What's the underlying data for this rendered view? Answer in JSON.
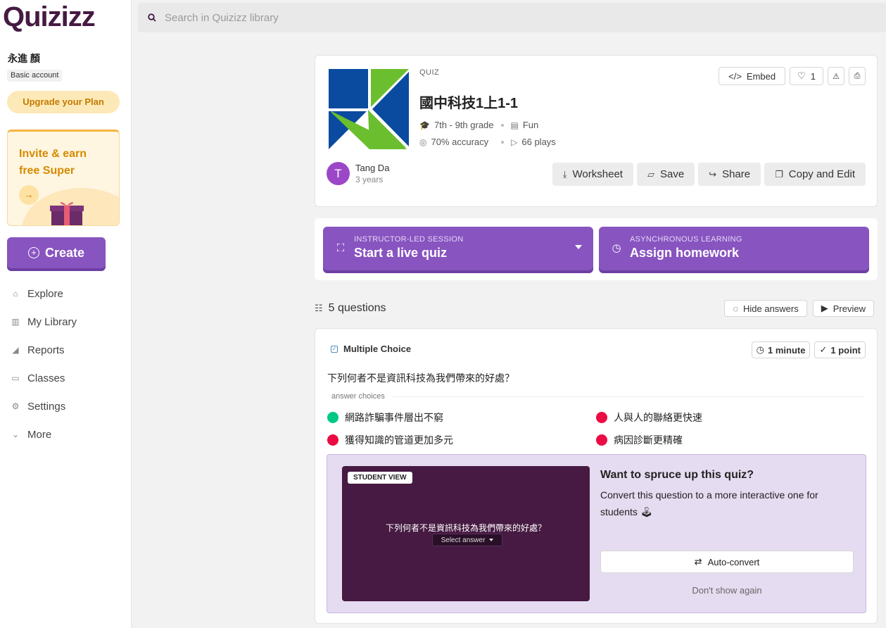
{
  "app": {
    "logo": "Quizizz"
  },
  "sidebar": {
    "user_name": "永進 顏",
    "account_type": "Basic account",
    "upgrade_label": "Upgrade your Plan",
    "invite_title": "Invite & earn free Super",
    "create_label": "Create",
    "nav": [
      {
        "label": "Explore",
        "icon": "compass-icon"
      },
      {
        "label": "My Library",
        "icon": "library-icon"
      },
      {
        "label": "Reports",
        "icon": "reports-icon"
      },
      {
        "label": "Classes",
        "icon": "classes-icon"
      },
      {
        "label": "Settings",
        "icon": "gear-icon"
      },
      {
        "label": "More",
        "icon": "chevron-down-icon"
      }
    ]
  },
  "search": {
    "placeholder": "Search in Quizizz library"
  },
  "quiz": {
    "type_label": "QUIZ",
    "title": "國中科技1上1-1",
    "grade": "7th - 9th grade",
    "category": "Fun",
    "accuracy": "70% accuracy",
    "plays": "66 plays",
    "embed_label": "Embed",
    "likes": "1",
    "author": "Tang Da",
    "author_initial": "T",
    "author_time": "3 years",
    "actions": {
      "worksheet": "Worksheet",
      "save": "Save",
      "share": "Share",
      "copy_edit": "Copy and Edit"
    }
  },
  "session": {
    "live_sub": "INSTRUCTOR-LED SESSION",
    "live_main": "Start a live quiz",
    "hw_sub": "ASYNCHRONOUS LEARNING",
    "hw_main": "Assign homework"
  },
  "questions": {
    "count_label": "5 questions",
    "hide_answers": "Hide answers",
    "preview": "Preview"
  },
  "question": {
    "type": "Multiple Choice",
    "time": "1 minute",
    "points": "1 point",
    "text": "下列何者不是資訊科技為我們帶來的好處？",
    "answer_label": "answer choices",
    "answers": [
      {
        "text": "網路詐騙事件層出不窮",
        "correct": true
      },
      {
        "text": "人與人的聯絡更快速",
        "correct": false
      },
      {
        "text": "獲得知識的管道更加多元",
        "correct": false
      },
      {
        "text": "病因診斷更精確",
        "correct": false
      }
    ]
  },
  "spruce": {
    "student_view_badge": "STUDENT VIEW",
    "preview_question": "下列何者不是資訊科技為我們帶來的好處？",
    "select_answer": "Select answer",
    "title": "Want to spruce up this quiz?",
    "description": "Convert this question to a more interactive one for students 🕹",
    "auto_convert": "Auto-convert",
    "dont_show": "Don't show again"
  },
  "colors": {
    "brand_purple": "#8854c0",
    "logo": "#461a42",
    "correct": "#00c985",
    "wrong": "#ec0b43"
  }
}
